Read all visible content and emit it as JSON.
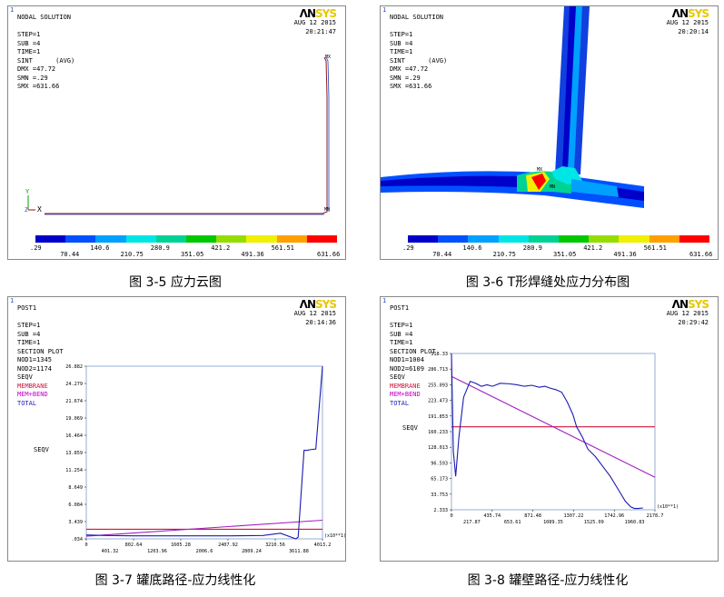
{
  "colors": {
    "contour": [
      "#0000c8",
      "#0050ff",
      "#00a0ff",
      "#00e6e6",
      "#00d296",
      "#00c800",
      "#96dc00",
      "#f0f000",
      "#ffa000",
      "#ff0000"
    ]
  },
  "panel1": {
    "index": "1",
    "header": [
      "NODAL SOLUTION",
      "",
      "STEP=1",
      "SUB =4",
      "TIME=1",
      "SINT      (AVG)",
      "DMX =47.72",
      "SMN =.29",
      "SMX =631.66"
    ],
    "date": "AUG 12 2015",
    "time": "20:21:47",
    "mx_label": "MX",
    "mn_label": "MN",
    "axis_y": "Y",
    "axis_z": "Z",
    "axis_x": "X",
    "legend_ticks_top": [
      ".29",
      "140.6",
      "280.9",
      "421.2",
      "561.51"
    ],
    "legend_ticks_bottom": [
      "70.44",
      "210.75",
      "351.05",
      "491.36",
      "631.66"
    ]
  },
  "panel2": {
    "index": "1",
    "header": [
      "NODAL SOLUTION",
      "",
      "STEP=1",
      "SUB =4",
      "TIME=1",
      "SINT      (AVG)",
      "DMX =47.72",
      "SMN =.29",
      "SMX =631.66"
    ],
    "date": "AUG 12 2015",
    "time": "20:20:14",
    "mx_label": "MX",
    "mn_label": "MN",
    "legend_ticks_top": [
      ".29",
      "140.6",
      "280.9",
      "421.2",
      "561.51"
    ],
    "legend_ticks_bottom": [
      "70.44",
      "210.75",
      "351.05",
      "491.36",
      "631.66"
    ]
  },
  "panel3": {
    "index": "1",
    "header": [
      "POST1",
      "",
      "STEP=1",
      "SUB =4",
      "TIME=1",
      "SECTION PLOT",
      "NOD1=1345",
      "NOD2=1174",
      "SEQV"
    ],
    "legend": [
      "MEMBRANE",
      "MEM+BEND",
      "TOTAL"
    ],
    "date": "AUG 12 2015",
    "time": "20:14:36",
    "ylabel": "SEQV"
  },
  "panel4": {
    "index": "1",
    "header": [
      "POST1",
      "",
      "STEP=1",
      "SUB =4",
      "TIME=1",
      "SECTION PLOT",
      "NOD1=1004",
      "NOD2=6109",
      "SEQV"
    ],
    "legend": [
      "MEMBRANE",
      "MEM+BEND",
      "TOTAL"
    ],
    "date": "AUG 12 2015",
    "time": "20:29:42",
    "ylabel": "SEQV"
  },
  "captions": [
    "图 3-5 应力云图",
    "图 3-6 T形焊缝处应力分布图",
    "图 3-7 罐底路径-应力线性化",
    "图 3-8 罐壁路径-应力线性化"
  ],
  "chart_data": [
    {
      "type": "line",
      "ylabel": "SEQV",
      "x_multiplier": "(x10**1)",
      "xlim": [
        0,
        4013.2
      ],
      "ylim": [
        0.034,
        26.882
      ],
      "y_ticks": [
        ".034",
        "3.439",
        "6.084",
        "8.649",
        "11.254",
        "13.859",
        "16.464",
        "19.069",
        "21.674",
        "24.279",
        "26.882"
      ],
      "x_ticks_top": [
        "0",
        "802.64",
        "1605.28",
        "2407.92",
        "3210.56",
        "4013.2"
      ],
      "x_ticks_bottom": [
        "401.32",
        "1203.96",
        "2006.6",
        "2809.24",
        "3611.88"
      ],
      "series": [
        {
          "name": "MEMBRANE",
          "color": "#d0143a",
          "x": [
            0,
            4013.2
          ],
          "y": [
            1.53,
            1.53
          ]
        },
        {
          "name": "MEM+BEND",
          "color": "#a020c0",
          "x": [
            0,
            4013.2
          ],
          "y": [
            0.45,
            2.93
          ]
        },
        {
          "name": "TOTAL",
          "color": "#1a1ab0",
          "x": [
            0,
            300,
            800,
            1600,
            2400,
            3000,
            3300,
            3560,
            3600,
            3700,
            3760,
            3800,
            3900,
            4013.2
          ],
          "y": [
            0.65,
            0.55,
            0.5,
            0.5,
            0.5,
            0.55,
            0.9,
            0.04,
            0.3,
            13.8,
            13.8,
            13.9,
            14,
            26.88
          ]
        }
      ]
    },
    {
      "type": "line",
      "ylabel": "SEQV",
      "x_multiplier": "(x10**1)",
      "xlim": [
        0,
        2178.7
      ],
      "ylim": [
        2.333,
        318.33
      ],
      "y_ticks": [
        "2.333",
        "33.753",
        "65.173",
        "96.593",
        "128.013",
        "160.233",
        "191.853",
        "223.473",
        "255.093",
        "286.713",
        "318.33"
      ],
      "x_ticks_top": [
        "0",
        "435.74",
        "871.48",
        "1307.22",
        "1742.96",
        "2178.7"
      ],
      "x_ticks_bottom": [
        "217.87",
        "653.61",
        "1089.35",
        "1525.09",
        "1960.83"
      ],
      "series": [
        {
          "name": "MEMBRANE",
          "color": "#d0143a",
          "x": [
            0,
            2178.7
          ],
          "y": [
            170,
            170
          ]
        },
        {
          "name": "MEM+BEND",
          "color": "#a020c0",
          "x": [
            0,
            2178.7
          ],
          "y": [
            272,
            68
          ]
        },
        {
          "name": "TOTAL",
          "color": "#1a1ab0",
          "x": [
            0,
            20,
            45,
            80,
            130,
            200,
            260,
            320,
            380,
            440,
            520,
            620,
            700,
            780,
            860,
            940,
            1000,
            1060,
            1120,
            1180,
            1240,
            1300,
            1340,
            1400,
            1460,
            1540,
            1620,
            1700,
            1780,
            1860,
            1920,
            1960,
            2000,
            2050
          ],
          "y": [
            318,
            120,
            70,
            150,
            230,
            262,
            258,
            252,
            255,
            252,
            258,
            257,
            255,
            252,
            254,
            250,
            252,
            248,
            245,
            240,
            220,
            195,
            170,
            150,
            125,
            110,
            90,
            70,
            45,
            20,
            8,
            5,
            5,
            6
          ]
        }
      ]
    }
  ]
}
